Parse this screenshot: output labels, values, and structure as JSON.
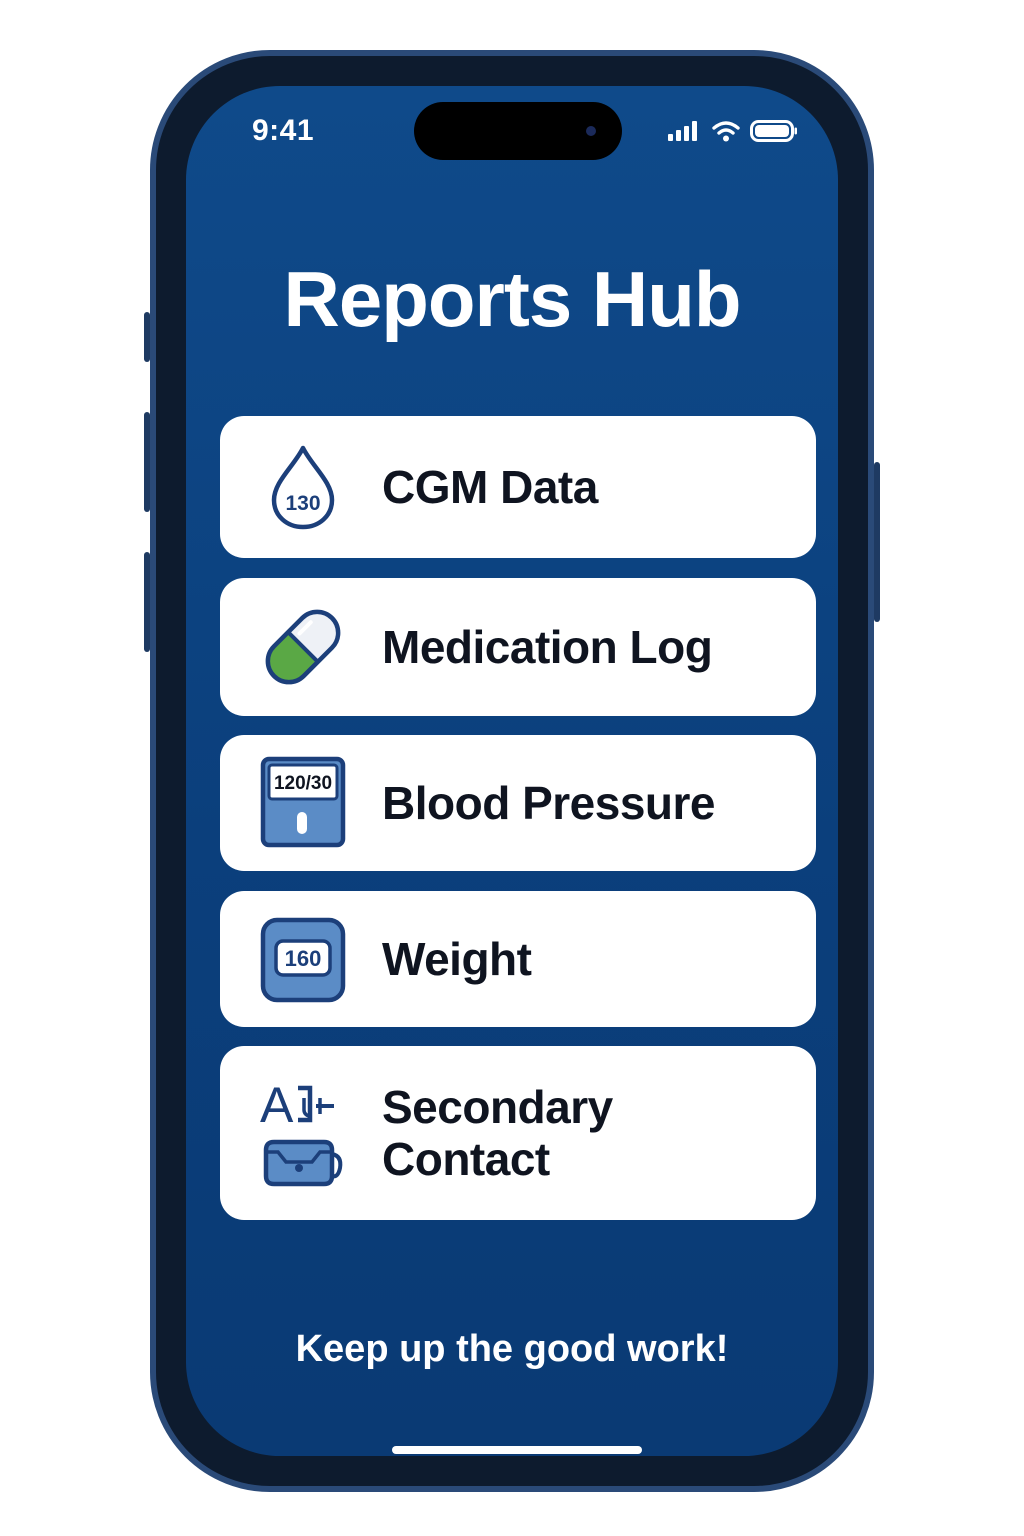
{
  "status_bar": {
    "time": "9:41",
    "icons": [
      "cellular-signal-icon",
      "wifi-icon",
      "battery-icon"
    ]
  },
  "page": {
    "title": "Reports Hub"
  },
  "reports": {
    "items": [
      {
        "label": "CGM Data",
        "icon": "glucose-drop-icon",
        "icon_text": "130"
      },
      {
        "label": "Medication Log",
        "icon": "pill-capsule-icon"
      },
      {
        "label": "Blood Pressure",
        "icon": "blood-pressure-monitor-icon",
        "icon_text": "120/30"
      },
      {
        "label": "Weight",
        "icon": "scale-icon",
        "icon_text": "160"
      },
      {
        "label_line1": "Secondary",
        "label_line2": "Contact",
        "icon": "contact-icon",
        "icon_text": "A"
      }
    ]
  },
  "footer": {
    "message": "Keep up the good work!"
  },
  "colors": {
    "background": "#0b3f7c",
    "card": "#ffffff",
    "icon_stroke": "#1c3f7a",
    "icon_fill": "#5b8cc6",
    "pill_green": "#5aa845",
    "text_dark": "#0f1420"
  }
}
